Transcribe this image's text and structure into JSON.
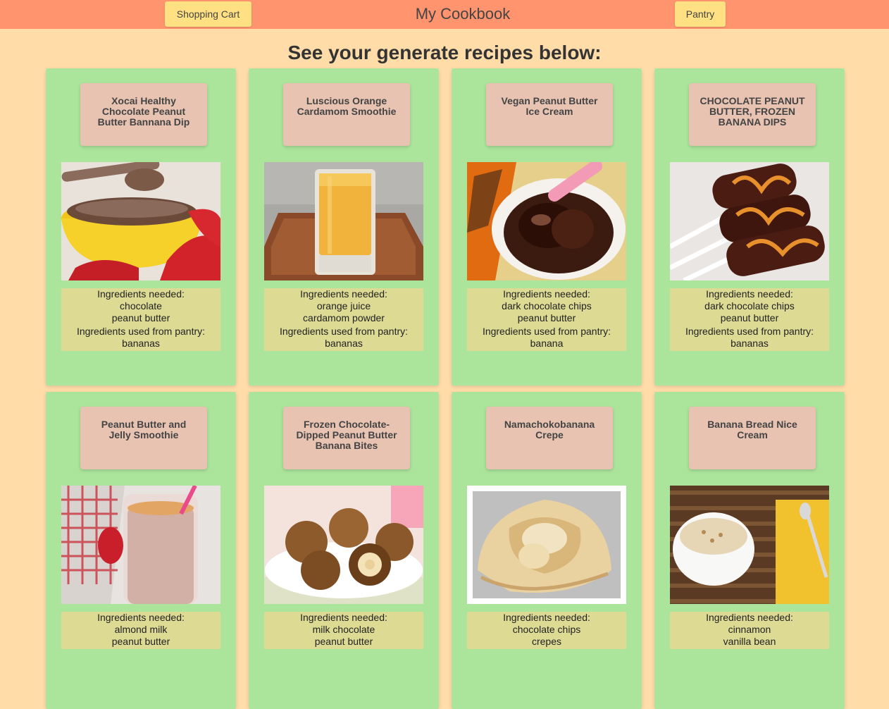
{
  "header": {
    "shopping_cart_label": "Shopping Cart",
    "title": "My Cookbook",
    "pantry_label": "Pantry"
  },
  "page_heading": "See your generate recipes below:",
  "ingredients_needed_label": "Ingredients needed:",
  "pantry_used_label": "Ingredients used from pantry:",
  "colors": {
    "topbar": "#ff946e",
    "background": "#ffdca8",
    "card": "#abe49b",
    "title_box": "#e8c3b2",
    "ingredients_box": "#ddda94",
    "nav_button": "#ffe082"
  },
  "recipes": [
    {
      "title": "Xocai Healthy Chocolate Peanut Butter Bannana Dip",
      "image": "chocolate-dip-photo",
      "needed": [
        "chocolate",
        "peanut butter"
      ],
      "pantry": [
        "bananas"
      ]
    },
    {
      "title": "Luscious Orange Cardamom Smoothie",
      "image": "orange-smoothie-photo",
      "needed": [
        "orange juice",
        "cardamom powder"
      ],
      "pantry": [
        "bananas"
      ]
    },
    {
      "title": "Vegan Peanut Butter Ice Cream",
      "image": "ice-cream-photo",
      "needed": [
        "dark chocolate chips",
        "peanut butter"
      ],
      "pantry": [
        "banana"
      ]
    },
    {
      "title": "CHOCOLATE PEANUT BUTTER, FROZEN BANANA DIPS",
      "image": "banana-pops-photo",
      "needed": [
        "dark chocolate chips",
        "peanut butter"
      ],
      "pantry": [
        "bananas"
      ]
    },
    {
      "title": "Peanut Butter and Jelly Smoothie",
      "image": "pbj-smoothie-photo",
      "needed": [
        "almond milk",
        "peanut butter"
      ],
      "pantry": []
    },
    {
      "title": "Frozen Chocolate-Dipped Peanut Butter Banana Bites",
      "image": "banana-bites-photo",
      "needed": [
        "milk chocolate",
        "peanut butter"
      ],
      "pantry": []
    },
    {
      "title": "Namachokobanana Crepe",
      "image": "crepe-photo",
      "needed": [
        "chocolate chips",
        "crepes"
      ],
      "pantry": []
    },
    {
      "title": "Banana Bread Nice Cream",
      "image": "nice-cream-photo",
      "needed": [
        "cinnamon",
        "vanilla bean"
      ],
      "pantry": []
    }
  ]
}
